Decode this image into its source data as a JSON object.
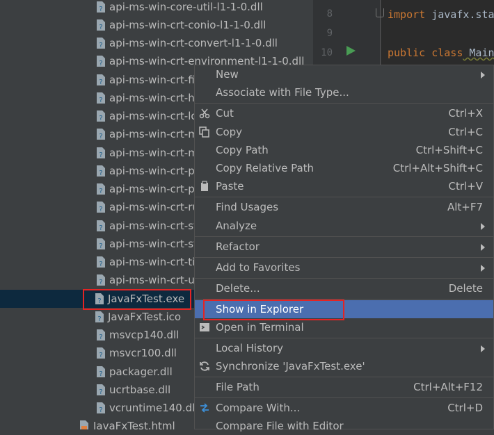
{
  "project_tree": {
    "rows": [
      {
        "name": "api-ms-win-core-util-l1-1-0.dll"
      },
      {
        "name": "api-ms-win-crt-conio-l1-1-0.dll"
      },
      {
        "name": "api-ms-win-crt-convert-l1-1-0.dll"
      },
      {
        "name": "api-ms-win-crt-environment-l1-1-0.dll"
      },
      {
        "name": "api-ms-win-crt-fil"
      },
      {
        "name": "api-ms-win-crt-he"
      },
      {
        "name": "api-ms-win-crt-lo"
      },
      {
        "name": "api-ms-win-crt-m"
      },
      {
        "name": "api-ms-win-crt-m"
      },
      {
        "name": "api-ms-win-crt-p"
      },
      {
        "name": "api-ms-win-crt-p"
      },
      {
        "name": "api-ms-win-crt-ru"
      },
      {
        "name": "api-ms-win-crt-st"
      },
      {
        "name": "api-ms-win-crt-st"
      },
      {
        "name": "api-ms-win-crt-ti"
      },
      {
        "name": "api-ms-win-crt-u"
      },
      {
        "name": "JavaFxTest.exe"
      },
      {
        "name": "JavaFxTest.ico"
      },
      {
        "name": "msvcp140.dll"
      },
      {
        "name": "msvcr100.dll"
      },
      {
        "name": "packager.dll"
      },
      {
        "name": "ucrtbase.dll"
      },
      {
        "name": "vcruntime140.dll"
      },
      {
        "name": "JavaFxTest.html"
      }
    ]
  },
  "editor": {
    "lines": [
      {
        "num": "8",
        "kw": "import",
        "rest": " javafx.sta"
      },
      {
        "num": "9",
        "kw": "",
        "rest": ""
      },
      {
        "num": "10",
        "kw": "public class",
        "rest": " Main"
      }
    ]
  },
  "context_menu": {
    "items": [
      {
        "label": "New",
        "shortcut": "",
        "submenu": true,
        "icon": ""
      },
      {
        "label": "Associate with File Type...",
        "shortcut": "",
        "submenu": false,
        "icon": ""
      },
      {
        "label": "Cut",
        "shortcut": "Ctrl+X",
        "submenu": false,
        "icon": "scissors-icon"
      },
      {
        "label": "Copy",
        "shortcut": "Ctrl+C",
        "submenu": false,
        "icon": "copy-icon"
      },
      {
        "label": "Copy Path",
        "shortcut": "Ctrl+Shift+C",
        "submenu": false,
        "icon": ""
      },
      {
        "label": "Copy Relative Path",
        "shortcut": "Ctrl+Alt+Shift+C",
        "submenu": false,
        "icon": ""
      },
      {
        "label": "Paste",
        "shortcut": "Ctrl+V",
        "submenu": false,
        "icon": "clipboard-icon"
      },
      {
        "label": "Find Usages",
        "shortcut": "Alt+F7",
        "submenu": false,
        "icon": ""
      },
      {
        "label": "Analyze",
        "shortcut": "",
        "submenu": true,
        "icon": ""
      },
      {
        "label": "Refactor",
        "shortcut": "",
        "submenu": true,
        "icon": ""
      },
      {
        "label": "Add to Favorites",
        "shortcut": "",
        "submenu": true,
        "icon": ""
      },
      {
        "label": "Delete...",
        "shortcut": "Delete",
        "submenu": false,
        "icon": ""
      },
      {
        "label": "Show in Explorer",
        "shortcut": "",
        "submenu": false,
        "icon": ""
      },
      {
        "label": "Open in Terminal",
        "shortcut": "",
        "submenu": false,
        "icon": "terminal-icon"
      },
      {
        "label": "Local History",
        "shortcut": "",
        "submenu": true,
        "icon": ""
      },
      {
        "label": "Synchronize 'JavaFxTest.exe'",
        "shortcut": "",
        "submenu": false,
        "icon": "sync-icon"
      },
      {
        "label": "File Path",
        "shortcut": "Ctrl+Alt+F12",
        "submenu": false,
        "icon": ""
      },
      {
        "label": "Compare With...",
        "shortcut": "Ctrl+D",
        "submenu": false,
        "icon": "compare-icon"
      },
      {
        "label": "Compare File with Editor",
        "shortcut": "",
        "submenu": false,
        "icon": ""
      }
    ]
  },
  "colors": {
    "menu_highlight": "#4b6eaf",
    "tree_selection": "#0d293e",
    "annotation_box": "#e32424",
    "background": "#3c3f41",
    "editor_background": "#2b2b2b"
  }
}
